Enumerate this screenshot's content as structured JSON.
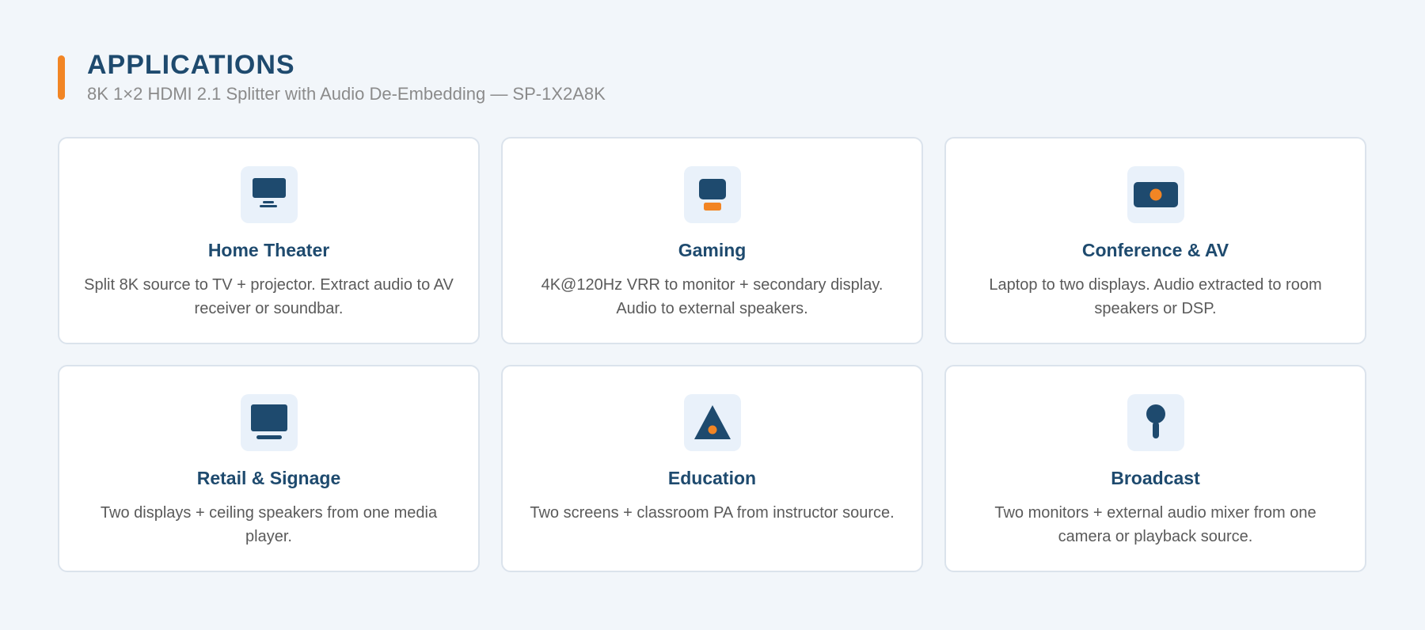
{
  "header": {
    "title": "APPLICATIONS",
    "subtitle": "8K 1×2 HDMI 2.1 Splitter with Audio De-Embedding — SP-1X2A8K"
  },
  "colors": {
    "accent": "#f28524",
    "primary": "#1e4a6e",
    "background": "#f2f6fa",
    "icon_bg": "#e9f1fa"
  },
  "cards": [
    {
      "icon": "monitor-icon",
      "title": "Home Theater",
      "description": "Split 8K source to TV + projector. Extract audio to AV receiver or soundbar."
    },
    {
      "icon": "gamepad-icon",
      "title": "Gaming",
      "description": "4K@120Hz VRR to monitor + secondary display. Audio to external speakers."
    },
    {
      "icon": "projector-icon",
      "title": "Conference & AV",
      "description": "Laptop to two displays. Audio extracted to room speakers or DSP."
    },
    {
      "icon": "display-icon",
      "title": "Retail & Signage",
      "description": "Two displays + ceiling speakers from one media player."
    },
    {
      "icon": "triangle-icon",
      "title": "Education",
      "description": "Two screens + classroom PA from instructor source."
    },
    {
      "icon": "microphone-icon",
      "title": "Broadcast",
      "description": "Two monitors + external audio mixer from one camera or playback source."
    }
  ]
}
